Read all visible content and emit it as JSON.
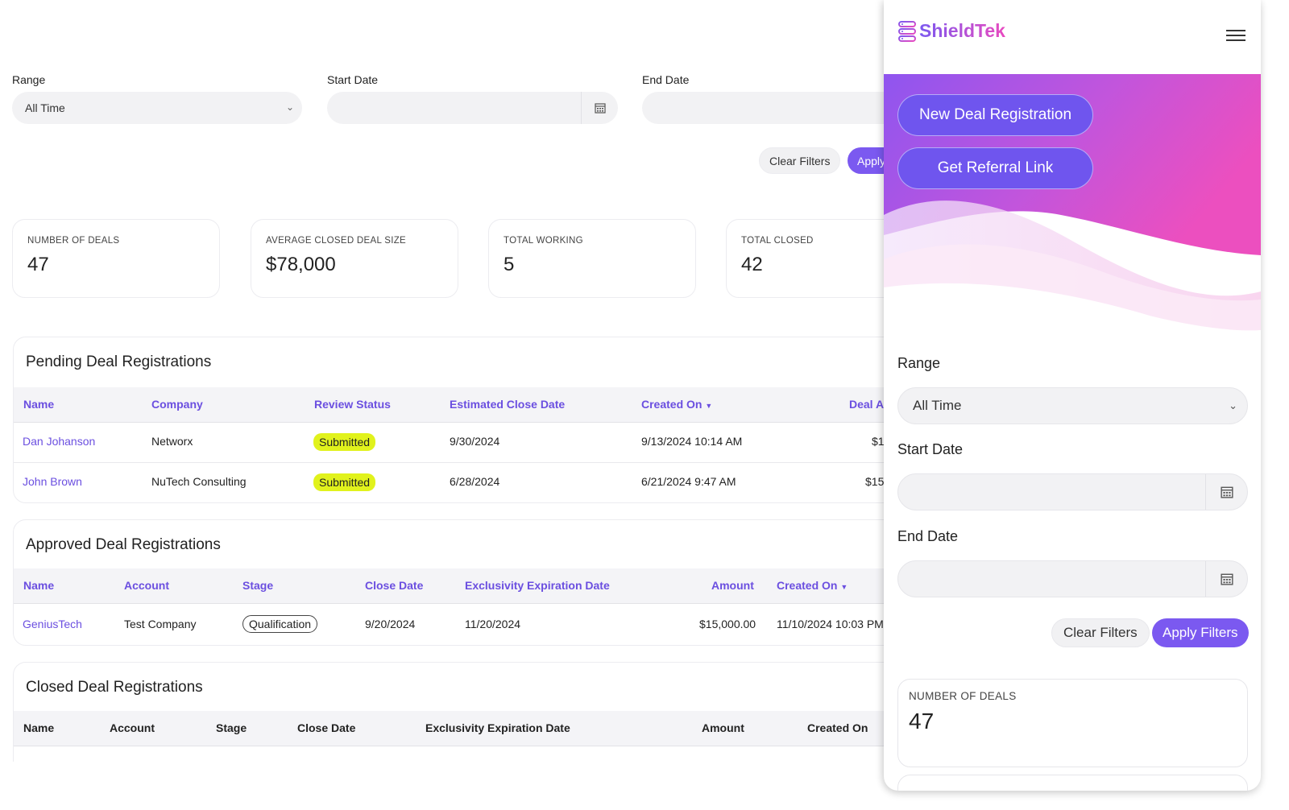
{
  "brand": {
    "name": "ShieldTek",
    "accent": "#7b59f0",
    "accent_end": "#e94ac0"
  },
  "filters": {
    "range_label": "Range",
    "range_value": "All Time",
    "start_label": "Start Date",
    "end_label": "End Date",
    "clear_label": "Clear Filters",
    "apply_label_partial": "Apply",
    "apply_label": "Apply Filters"
  },
  "stats": [
    {
      "label": "NUMBER OF DEALS",
      "value": "47"
    },
    {
      "label": "AVERAGE CLOSED DEAL SIZE",
      "value": "$78,000"
    },
    {
      "label": "TOTAL WORKING",
      "value": "5"
    },
    {
      "label": "TOTAL CLOSED",
      "value": "42"
    }
  ],
  "pending": {
    "title": "Pending Deal Registrations",
    "columns": [
      "Name",
      "Company",
      "Review Status",
      "Estimated Close Date",
      "Created On",
      "Deal A"
    ],
    "rows": [
      {
        "name": "Dan Johanson",
        "company": "Networx",
        "status": "Submitted",
        "close": "9/30/2024",
        "created": "9/13/2024 10:14 AM",
        "amount": "$1"
      },
      {
        "name": "John Brown",
        "company": "NuTech Consulting",
        "status": "Submitted",
        "close": "6/28/2024",
        "created": "6/21/2024 9:47 AM",
        "amount": "$15"
      }
    ]
  },
  "approved": {
    "title": "Approved Deal Registrations",
    "columns": [
      "Name",
      "Account",
      "Stage",
      "Close Date",
      "Exclusivity Expiration Date",
      "Amount",
      "Created On"
    ],
    "rows": [
      {
        "name": "GeniusTech",
        "account": "Test Company",
        "stage": "Qualification",
        "close": "9/20/2024",
        "expiry": "11/20/2024",
        "amount": "$15,000.00",
        "created": "11/10/2024 10:03 PM"
      }
    ]
  },
  "closed": {
    "title": "Closed Deal Registrations",
    "columns": [
      "Name",
      "Account",
      "Stage",
      "Close Date",
      "Exclusivity Expiration Date",
      "Amount",
      "Created On"
    ]
  },
  "mobile": {
    "new_deal_label": "New Deal Registration",
    "referral_label": "Get Referral Link",
    "range_label": "Range",
    "range_value": "All Time",
    "start_label": "Start Date",
    "end_label": "End Date",
    "clear_label": "Clear Filters",
    "apply_label": "Apply Filters",
    "card_label": "NUMBER OF DEALS",
    "card_value": "47"
  }
}
